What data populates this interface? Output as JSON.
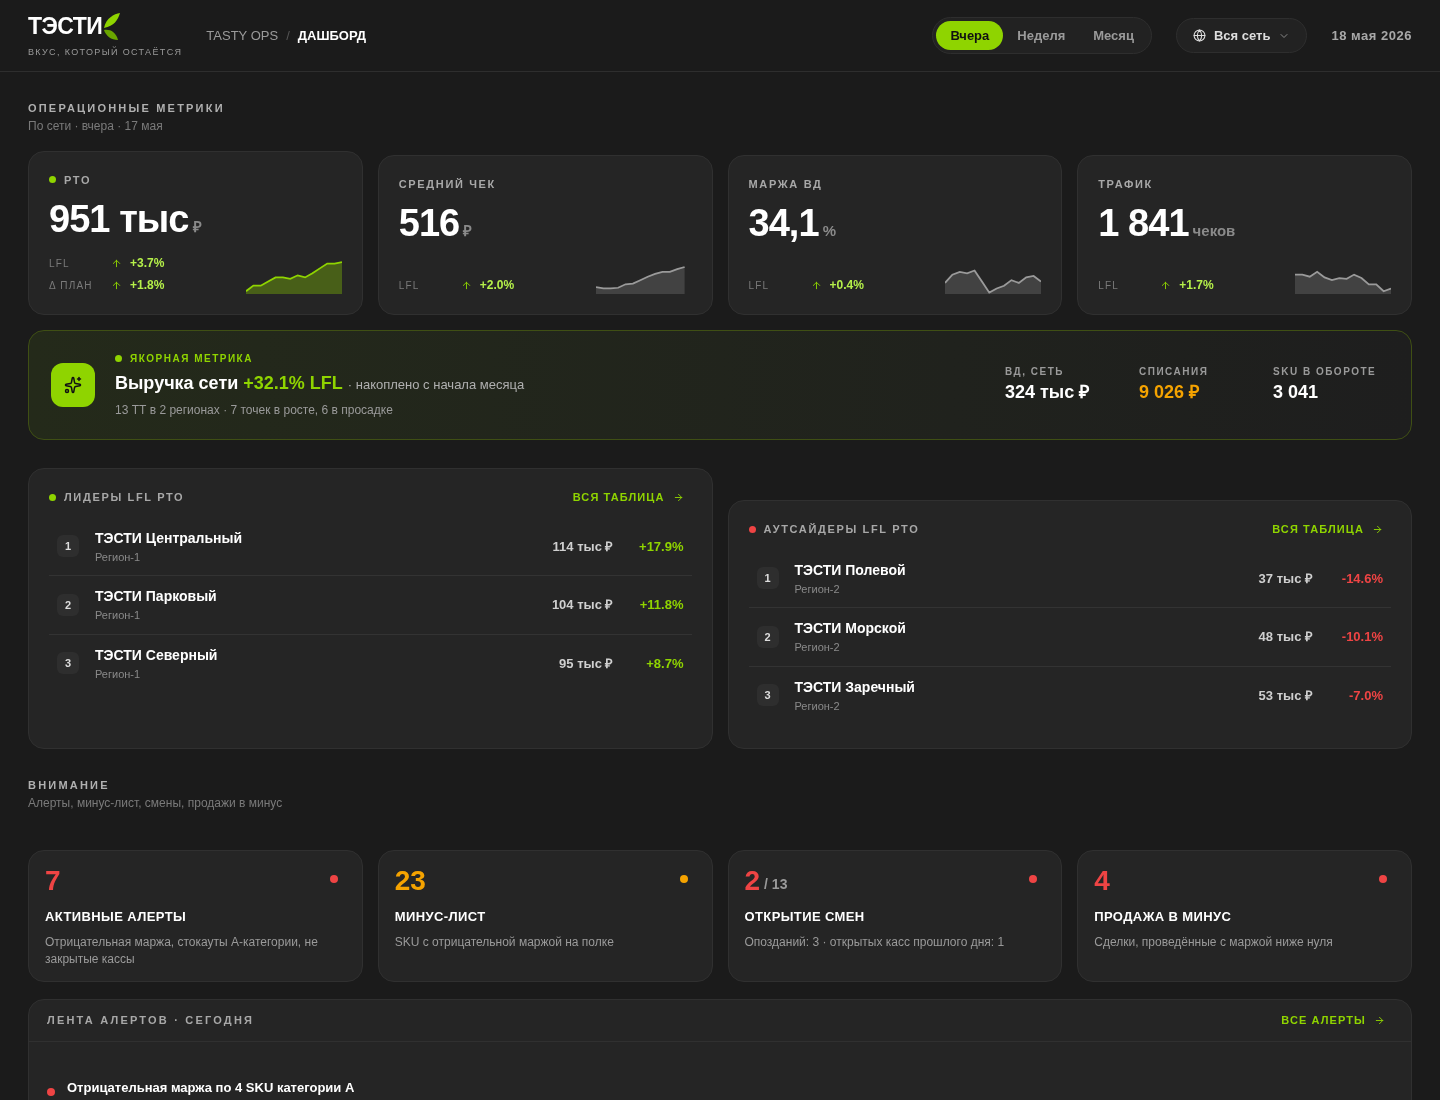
{
  "brand": {
    "logo": "ТЭСТИ",
    "tagline": "ВКУС, КОТОРЫЙ ОСТАЁТСЯ"
  },
  "breadcrumbs": [
    "TASTY OPS",
    "ДАШБОРД"
  ],
  "breadcrumb_separator": "/",
  "periods": [
    {
      "label": "Вчера",
      "selected": true
    },
    {
      "label": "Неделя",
      "selected": false
    },
    {
      "label": "Месяц",
      "selected": false
    }
  ],
  "scope": "Вся сеть",
  "date": "18 мая 2026",
  "metrics_section": {
    "title": "ОПЕРАЦИОННЫЕ МЕТРИКИ",
    "subtitle": "По сети · вчера · 17 мая"
  },
  "metrics": [
    {
      "label": "РТО",
      "value": "951 тыс",
      "unit": "₽",
      "featured": true,
      "deltas": [
        {
          "label": "LFL",
          "value": "+3.7%"
        },
        {
          "label": "Δ ПЛАН",
          "value": "+1.8%"
        }
      ]
    },
    {
      "label": "СРЕДНИЙ ЧЕК",
      "value": "516",
      "unit": "₽",
      "featured": false,
      "deltas": [
        {
          "label": "LFL",
          "value": "+2.0%"
        }
      ]
    },
    {
      "label": "МАРЖА ВД",
      "value": "34,1",
      "unit": "%",
      "featured": false,
      "deltas": [
        {
          "label": "LFL",
          "value": "+0.4%"
        }
      ]
    },
    {
      "label": "ТРАФИК",
      "value": "1 841",
      "unit": "чеков",
      "featured": false,
      "deltas": [
        {
          "label": "LFL",
          "value": "+1.7%"
        }
      ]
    }
  ],
  "anchor": {
    "eyebrow": "ЯКОРНАЯ МЕТРИКА",
    "headline": "Выручка сети",
    "highlight": "+32.1% LFL",
    "note": "· накоплено с начала месяца",
    "detail": "13 ТТ в 2 регионах · 7 точек в росте, 6 в просадке",
    "stats": [
      {
        "label": "ВД, СЕТЬ",
        "value": "324 тыс ₽",
        "color": "#ffffff"
      },
      {
        "label": "СПИСАНИЯ",
        "value": "9 026 ₽",
        "color": "#f5a300"
      },
      {
        "label": "SKU В ОБОРОТЕ",
        "value": "3 041",
        "color": "#ffffff"
      }
    ]
  },
  "rankings": [
    {
      "title": "ЛИДЕРЫ LFL РТО",
      "color": "#8fd400",
      "link": "ВСЯ ТАБЛИЦА",
      "rows": [
        {
          "rank": "1",
          "name": "ТЭСТИ Центральный",
          "region": "Регион-1",
          "revenue": "114 тыс ₽",
          "change": "+17.9%"
        },
        {
          "rank": "2",
          "name": "ТЭСТИ Парковый",
          "region": "Регион-1",
          "revenue": "104 тыс ₽",
          "change": "+11.8%"
        },
        {
          "rank": "3",
          "name": "ТЭСТИ Северный",
          "region": "Регион-1",
          "revenue": "95 тыс ₽",
          "change": "+8.7%"
        }
      ]
    },
    {
      "title": "АУТСАЙДЕРЫ LFL РТО",
      "color": "#ef4444",
      "link": "ВСЯ ТАБЛИЦА",
      "rows": [
        {
          "rank": "1",
          "name": "ТЭСТИ Полевой",
          "region": "Регион-2",
          "revenue": "37 тыс ₽",
          "change": "-14.6%"
        },
        {
          "rank": "2",
          "name": "ТЭСТИ Морской",
          "region": "Регион-2",
          "revenue": "48 тыс ₽",
          "change": "-10.1%"
        },
        {
          "rank": "3",
          "name": "ТЭСТИ Заречный",
          "region": "Регион-2",
          "revenue": "53 тыс ₽",
          "change": "-7.0%"
        }
      ]
    }
  ],
  "attention_section": {
    "title": "ВНИМАНИЕ",
    "subtitle": "Алерты, минус-лист, смены, продажи в минус"
  },
  "attention": [
    {
      "count": "7",
      "title": "АКТИВНЫЕ АЛЕРТЫ",
      "description": "Отрицательная маржа, стокауты А-категории, не закрытые кассы",
      "color": "#ef4444"
    },
    {
      "count": "23",
      "title": "МИНУС-ЛИСТ",
      "description": "SKU с отрицательной маржой на полке",
      "color": "#f5a300"
    },
    {
      "count": "2",
      "total": "/ 13",
      "title": "ОТКРЫТИЕ СМЕН",
      "description": "Опозданий: 3 · открытых касс прошлого дня: 1",
      "color": "#ef4444"
    },
    {
      "count": "4",
      "title": "ПРОДАЖА В МИНУС",
      "description": "Сделки, проведённые с маржой ниже нуля",
      "color": "#ef4444"
    }
  ],
  "feed": {
    "title": "ЛЕНТА АЛЕРТОВ · СЕГОДНЯ",
    "link": "ВСЕ АЛЕРТЫ",
    "items": [
      {
        "text": "Отрицательная маржа по 4 SKU категории А",
        "color": "#ef4444"
      }
    ]
  }
}
